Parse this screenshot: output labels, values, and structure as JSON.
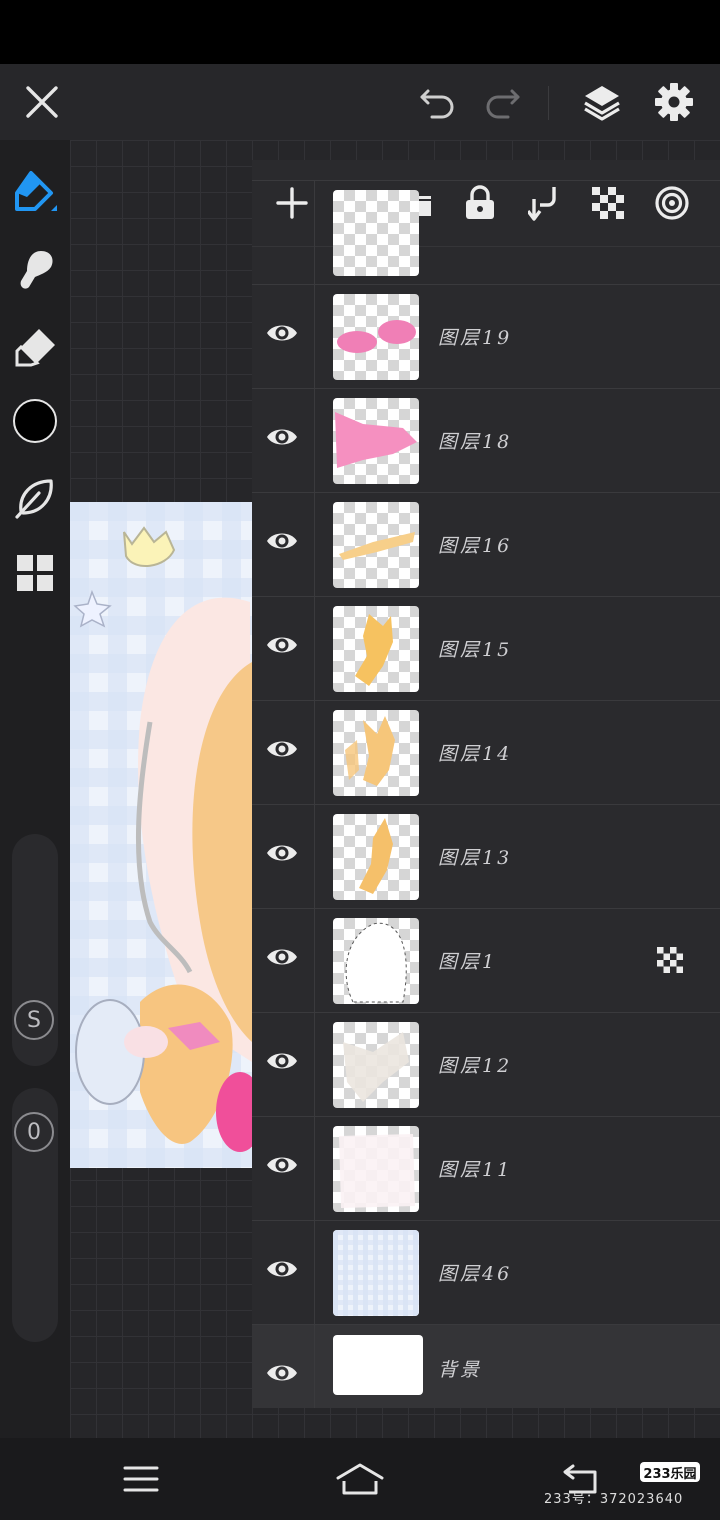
{
  "toolbar": {
    "close_icon": "close-icon",
    "undo_icon": "undo-icon",
    "redo_icon": "redo-icon",
    "layers_icon": "layers-icon",
    "settings_icon": "gear-icon"
  },
  "tools": {
    "items": [
      "brush-tool",
      "smudge-tool",
      "eraser-tool",
      "color-picker",
      "leaf-tool",
      "grid-menu"
    ],
    "active_color": "#000000",
    "accent": "#2196f3",
    "size_button": "S",
    "opacity_button": "0"
  },
  "layers_panel": {
    "actions": [
      "add-layer",
      "folder",
      "lock",
      "merge-down",
      "transparency",
      "layer-settings"
    ],
    "layers": [
      {
        "name": "图层19",
        "visible": true,
        "alpha_lock": false
      },
      {
        "name": "图层18",
        "visible": true,
        "alpha_lock": false
      },
      {
        "name": "图层16",
        "visible": true,
        "alpha_lock": false
      },
      {
        "name": "图层15",
        "visible": true,
        "alpha_lock": false
      },
      {
        "name": "图层14",
        "visible": true,
        "alpha_lock": false
      },
      {
        "name": "图层13",
        "visible": true,
        "alpha_lock": false
      },
      {
        "name": "图层1",
        "visible": true,
        "alpha_lock": true
      },
      {
        "name": "图层12",
        "visible": true,
        "alpha_lock": false
      },
      {
        "name": "图层11",
        "visible": true,
        "alpha_lock": false
      },
      {
        "name": "图层46",
        "visible": true,
        "alpha_lock": false
      },
      {
        "name": "背景",
        "visible": true,
        "alpha_lock": false
      }
    ]
  },
  "nav": {
    "menu_icon": "menu-icon",
    "home_icon": "home-icon",
    "back_icon": "back-icon"
  },
  "watermark": {
    "logo": "233乐园",
    "text": "233号：372023640"
  }
}
